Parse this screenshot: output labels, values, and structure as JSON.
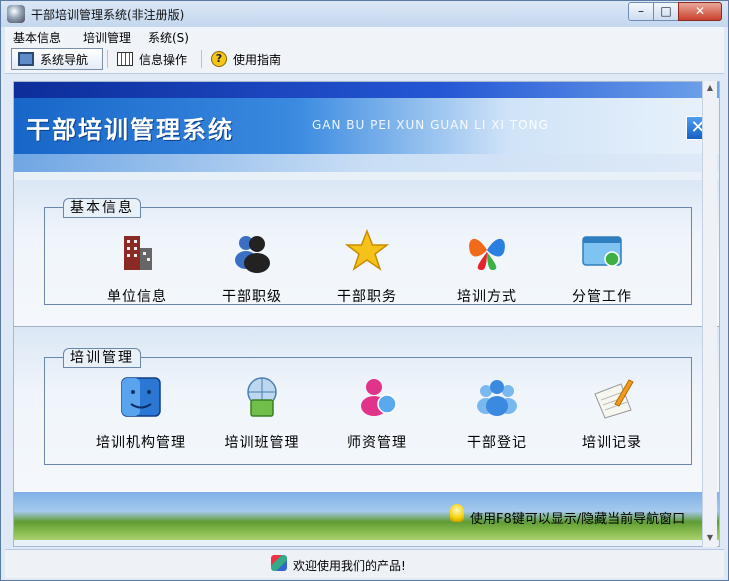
{
  "window": {
    "title": "干部培训管理系统(非注册版)",
    "min_symbol": "–",
    "max_symbol": "□",
    "close_symbol": "✕"
  },
  "menu": [
    {
      "label": "基本信息"
    },
    {
      "label": "培训管理"
    },
    {
      "label": "系统(S)"
    }
  ],
  "toolbar": [
    {
      "label": "系统导航",
      "icon": "monitor-icon",
      "active": true
    },
    {
      "label": "信息操作",
      "icon": "grid-icon"
    },
    {
      "label": "使用指南",
      "icon": "help-icon"
    }
  ],
  "banner": {
    "title": "干部培训管理系统",
    "subtitle": "GAN BU PEI XUN GUAN LI XI TONG",
    "close_symbol": "✕"
  },
  "groups": [
    {
      "title": "基本信息",
      "items": [
        {
          "label": "单位信息",
          "icon": "building-icon"
        },
        {
          "label": "干部职级",
          "icon": "users-icon"
        },
        {
          "label": "干部职务",
          "icon": "star-icon"
        },
        {
          "label": "培训方式",
          "icon": "butterfly-icon"
        },
        {
          "label": "分管工作",
          "icon": "window-icon"
        }
      ]
    },
    {
      "title": "培训管理",
      "items": [
        {
          "label": "培训机构管理",
          "icon": "finder-icon"
        },
        {
          "label": "培训班管理",
          "icon": "network-icon"
        },
        {
          "label": "师资管理",
          "icon": "teacher-icon"
        },
        {
          "label": "干部登记",
          "icon": "group-icon"
        },
        {
          "label": "培训记录",
          "icon": "notepad-icon"
        }
      ]
    }
  ],
  "hint": {
    "text": "使用F8键可以显示/隐藏当前导航窗口"
  },
  "status": {
    "text": "欢迎使用我们的产品!"
  },
  "colors": {
    "accent": "#1766c8",
    "banner_dark": "#0d2d9a",
    "grass": "#5f9c34"
  }
}
